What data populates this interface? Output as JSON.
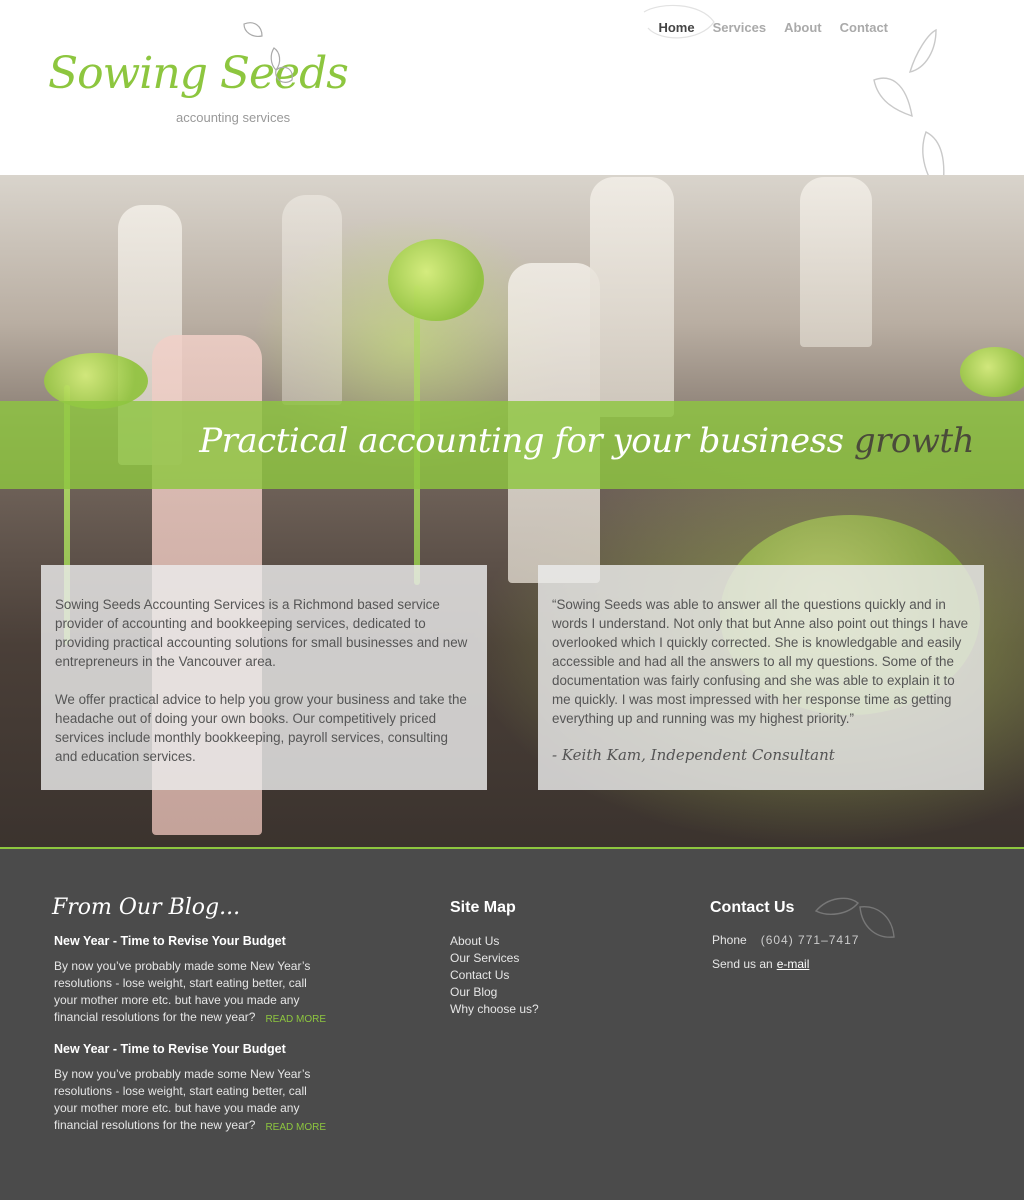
{
  "brand": {
    "name": "Sowing Seeds",
    "subtitle": "accounting services"
  },
  "nav": {
    "items": [
      {
        "label": "Home",
        "active": true
      },
      {
        "label": "Services",
        "active": false
      },
      {
        "label": "About",
        "active": false
      },
      {
        "label": "Contact",
        "active": false
      }
    ]
  },
  "hero": {
    "tagline_main": "Practical accounting for your business",
    "tagline_accent": "growth"
  },
  "about": {
    "paragraph_1": "Sowing Seeds Accounting Services is a Richmond based service provider of accounting and bookkeeping services, dedicated to providing practical accounting solutions for small businesses and new entrepreneurs in the Vancouver area.",
    "paragraph_2": "We offer practical advice to help you grow your business and take the headache out of doing your own books. Our competitively priced services include monthly bookkeeping, payroll services, consulting and education services."
  },
  "testimonial": {
    "quote": "“Sowing Seeds was able to answer all the questions quickly and in words I understand. Not only that but Anne also point out things I have overlooked which I quickly corrected. She is knowledgable and easily accessible and had all the answers to all my questions. Some of the documentation was fairly confusing and she was able to explain it to me quickly. I was most impressed with her response time as getting everything up and running was my highest priority.”",
    "author": "- Keith Kam, Independent Consultant"
  },
  "footer": {
    "blog": {
      "heading": "From Our Blog...",
      "posts": [
        {
          "title": "New Year - Time to Revise Your Budget",
          "excerpt": "By now you’ve probably made some New Year’s resolutions - lose weight, start eating better, call your mother more etc. but have you made any financial resolutions for the new year?",
          "read_more": "READ MORE"
        },
        {
          "title": "New Year - Time to Revise Your Budget",
          "excerpt": "By now you’ve probably made some New Year’s resolutions - lose weight, start eating better, call your mother more etc. but have you made any financial resolutions for the new year?",
          "read_more": "READ MORE"
        }
      ]
    },
    "sitemap": {
      "heading": "Site Map",
      "links": [
        "About Us",
        "Our Services",
        "Contact Us",
        "Our Blog",
        "Why choose us?"
      ]
    },
    "contact": {
      "heading": "Contact Us",
      "phone_label": "Phone",
      "phone_value": "(604) 771–7417",
      "email_prefix": "Send us an",
      "email_link": "e-mail"
    }
  },
  "colors": {
    "accent_green": "#8dc63f",
    "footer_bg": "#4b4b4b",
    "nav_active": "#444444"
  }
}
